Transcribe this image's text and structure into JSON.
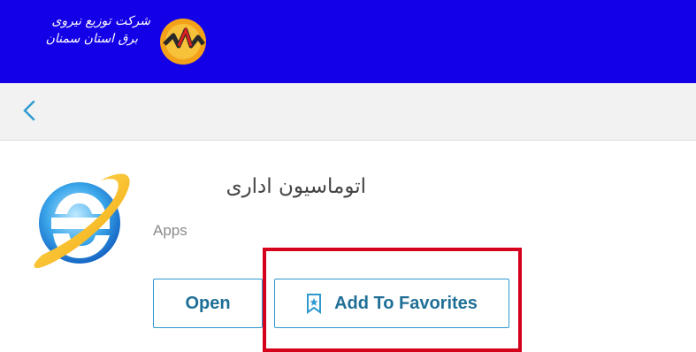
{
  "header": {
    "logo_line1": "شرکت توزیع نیروی",
    "logo_line2": "برق استان سمنان"
  },
  "app": {
    "title": "اتوماسیون اداری",
    "category": "Apps"
  },
  "buttons": {
    "open_label": "Open",
    "favorites_label": "Add To Favorites"
  },
  "icons": {
    "back": "chevron-left-icon",
    "app": "internet-explorer-icon",
    "favorite": "bookmark-star-icon",
    "logo": "power-company-logo"
  },
  "colors": {
    "header": "#1400e6",
    "accent": "#2f9ad0",
    "highlight": "#d4001c"
  }
}
